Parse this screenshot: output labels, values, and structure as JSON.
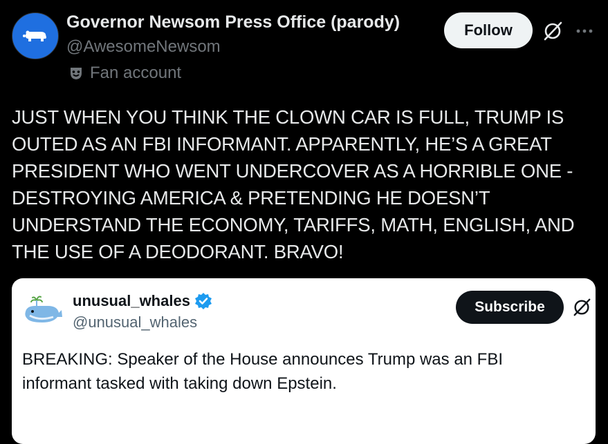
{
  "colors": {
    "background": "#000000",
    "text_primary": "#e7e9ea",
    "text_secondary": "#71767b",
    "avatar_blue": "#1f6fe0",
    "follow_bg": "#eff3f4",
    "card_bg": "#ffffff",
    "verified_blue": "#1d9bf0",
    "subscribe_bg": "#0f1419"
  },
  "post": {
    "author_name": "Governor Newsom Press Office (parody)",
    "author_handle": "@AwesomeNewsom",
    "fan_label": "Fan account",
    "avatar_icon": "bear-logo-icon",
    "follow_label": "Follow",
    "text": "JUST WHEN YOU THINK THE CLOWN CAR IS FULL, TRUMP IS OUTED AS AN FBI INFORMANT. APPARENTLY, HE’S A GREAT PRESIDENT WHO WENT UNDERCOVER AS A HORRIBLE ONE - DESTROYING AMERICA & PRETENDING HE DOESN’T UNDERSTAND THE ECONOMY, TARIFFS, MATH, ENGLISH, AND THE USE OF A DEODORANT. BRAVO!"
  },
  "quote": {
    "author_name": "unusual_whales",
    "author_handle": "@unusual_whales",
    "avatar_icon": "whale-logo-icon",
    "subscribe_label": "Subscribe",
    "text": "BREAKING: Speaker of the House announces Trump was an FBI informant tasked with taking down Epstein."
  }
}
